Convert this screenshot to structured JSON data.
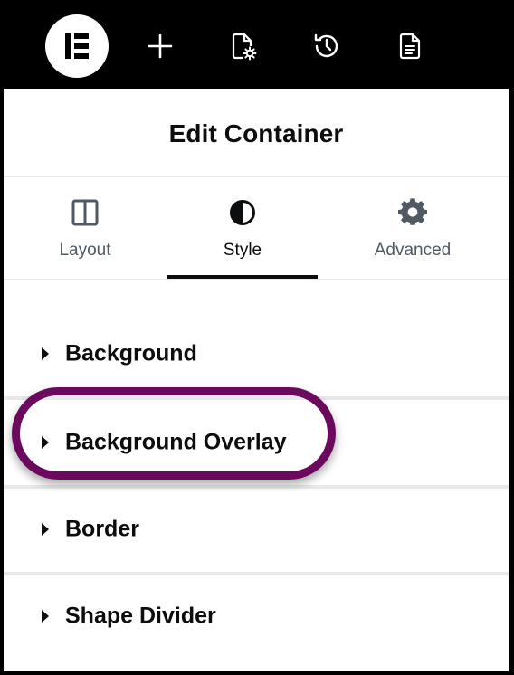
{
  "topbar": {
    "logo_icon": "elementor-logo-icon",
    "icons": [
      "add-icon",
      "page-settings-icon",
      "history-icon",
      "document-icon"
    ]
  },
  "header": {
    "title": "Edit Container"
  },
  "tabs": [
    {
      "label": "Layout",
      "icon": "columns-icon",
      "active": false
    },
    {
      "label": "Style",
      "icon": "contrast-icon",
      "active": true
    },
    {
      "label": "Advanced",
      "icon": "gear-icon",
      "active": false
    }
  ],
  "sections": [
    {
      "label": "Background",
      "highlighted": false
    },
    {
      "label": "Background Overlay",
      "highlighted": true
    },
    {
      "label": "Border",
      "highlighted": false
    },
    {
      "label": "Shape Divider",
      "highlighted": false
    }
  ],
  "colors": {
    "topbar": "#000000",
    "text": "#0c0d0e",
    "muted_text": "#515962",
    "divider": "#e6e8ea",
    "highlight_ring": "#6b0a5c"
  }
}
